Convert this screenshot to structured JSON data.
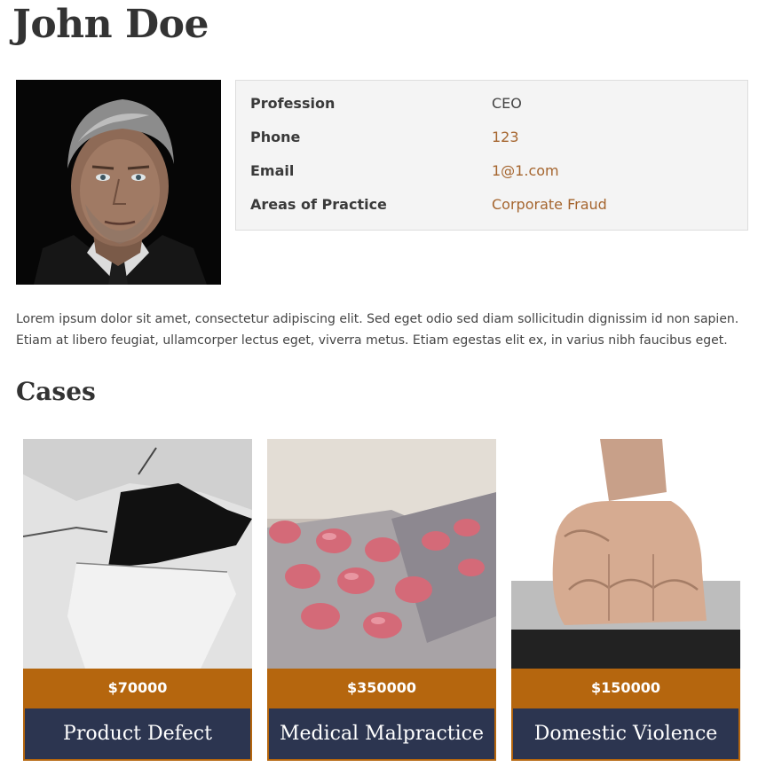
{
  "page": {
    "title": "John Doe"
  },
  "profile": {
    "rows": [
      {
        "label": "Profession",
        "value": "CEO"
      },
      {
        "label": "Phone",
        "value": "123"
      },
      {
        "label": "Email",
        "value": "1@1.com"
      },
      {
        "label": "Areas of Practice",
        "value": "Corporate Fraud"
      }
    ],
    "bio": "Lorem ipsum dolor sit amet, consectetur adipiscing elit. Sed eget odio sed diam sollicitudin dignissim id non sapien. Etiam at libero feugiat, ullamcorper lectus eget, viverra metus. Etiam egestas elit ex, in varius nibh faucibus eget."
  },
  "cases": {
    "heading": "Cases",
    "items": [
      {
        "price": "$70000",
        "name": "Product Defect"
      },
      {
        "price": "$350000",
        "name": "Medical Malpractice"
      },
      {
        "price": "$150000",
        "name": "Domestic Violence"
      }
    ]
  },
  "colors": {
    "accent": "#b5660e",
    "navy": "#2c3550",
    "link": "#a5652e"
  }
}
